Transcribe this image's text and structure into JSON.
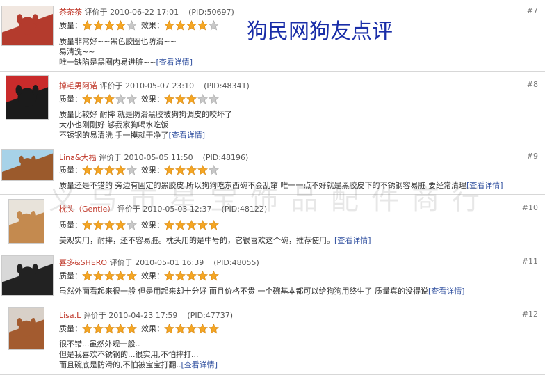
{
  "banner": "狗民网狗友点评",
  "watermark": "义乌市星宝饰品配件商行",
  "labels": {
    "quality": "质量：",
    "effect": "效果：",
    "detail": "[查看详情]",
    "reviewed_at": "评价于"
  },
  "colors": {
    "star_full": "#f5a623",
    "star_empty": "#c8c8c8",
    "user": "#c0392b",
    "detail": "#2f4f9f",
    "banner": "#1a2ea8"
  },
  "reviews": [
    {
      "user": "茶茶茶",
      "date": "2010-06-22 17:01",
      "pid": "(PID:50697)",
      "seq": "#7",
      "quality": 4,
      "effect": 4,
      "lines": [
        "质量非常好~~黑色胶圈也防滑~~",
        "易清洗~~",
        "唯一缺陷是黑圈内易进脏~~"
      ],
      "avatar_icon": "dog-photo-icon"
    },
    {
      "user": "掉毛男阿诺",
      "date": "2010-05-07 23:10",
      "pid": "(PID:48341)",
      "seq": "#8",
      "quality": 3,
      "effect": 3,
      "lines": [
        "质量比较好 耐摔 就是防滑黑胶被狗狗调皮的咬坏了",
        "大小也刚刚好 够我家狗喝水吃饭",
        "不锈钢的易清洗 手一摸就干净了"
      ],
      "avatar_icon": "dog-photo-icon"
    },
    {
      "user": "Lina&大福",
      "date": "2010-05-05 11:50",
      "pid": "(PID:48196)",
      "seq": "#9",
      "quality": 4,
      "effect": 4,
      "lines": [
        "质量还是不错的 旁边有固定的黑胶皮 所以狗狗吃东西碗不会乱窜 唯一一点不好就是黑胶皮下的不锈钢容易脏 要经常清理"
      ],
      "avatar_icon": "dog-photo-icon"
    },
    {
      "user": "枕头（Gentle）",
      "date": "2010-05-03 12:37",
      "pid": "(PID:48122)",
      "seq": "#10",
      "quality": 4,
      "effect": 5,
      "lines": [
        "美观实用，耐摔，还不容易脏。枕头用的是中号的，它很喜欢这个碗，推荐使用。"
      ],
      "avatar_icon": "dog-photo-icon"
    },
    {
      "user": "喜多&SHERO",
      "date": "2010-05-01 16:39",
      "pid": "(PID:48055)",
      "seq": "#11",
      "quality": 5,
      "effect": 5,
      "lines": [
        "虽然外面看起来很一般 但是用起来却十分好 而且价格不贵 一个碗基本都可以给狗狗用终生了 质量真的没得说"
      ],
      "avatar_icon": "dog-photo-icon"
    },
    {
      "user": "Lisa.L",
      "date": "2010-04-23 17:59",
      "pid": "(PID:47737)",
      "seq": "#12",
      "quality": 5,
      "effect": 5,
      "lines": [
        "很不错...虽然外观一般..",
        "但是我喜欢不锈钢的...很实用,不怕摔打...",
        "而且碗底是防滑的,不怕被宝宝打翻.."
      ],
      "avatar_icon": "dog-photo-icon"
    }
  ]
}
